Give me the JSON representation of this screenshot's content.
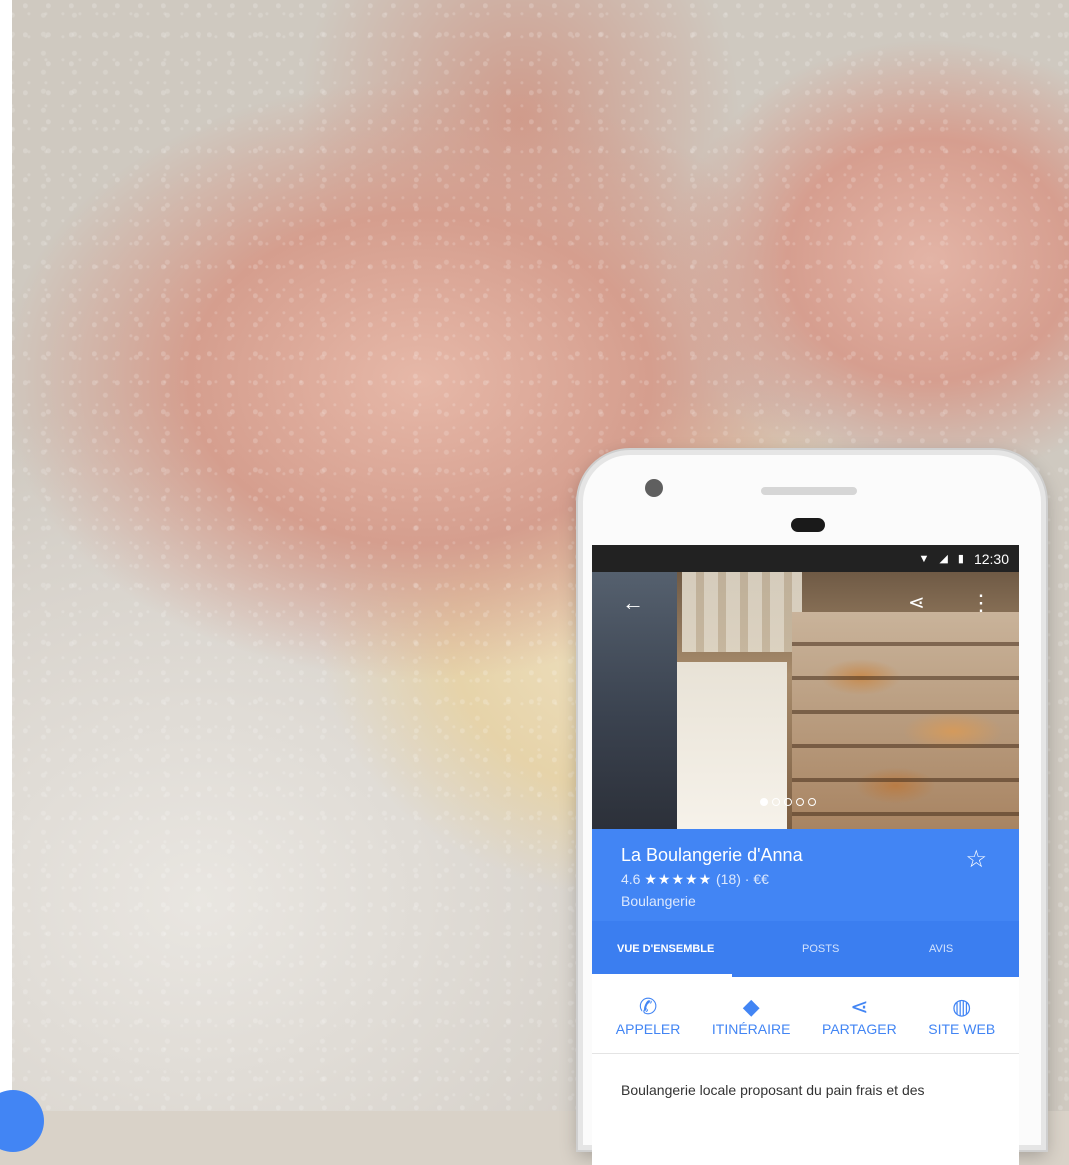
{
  "status_bar": {
    "time": "12:30"
  },
  "place": {
    "name": "La Boulangerie d'Anna",
    "rating": "4.6",
    "stars": "★★★★★",
    "reviews_price": "(18) · €€",
    "category": "Boulangerie"
  },
  "tabs": [
    {
      "label": "VUE D'ENSEMBLE",
      "active": true
    },
    {
      "label": "POSTS",
      "active": false
    },
    {
      "label": "AVIS",
      "active": false
    }
  ],
  "actions": [
    {
      "label": "APPELER",
      "icon": "phone-icon"
    },
    {
      "label": "ITINÉRAIRE",
      "icon": "directions-icon"
    },
    {
      "label": "PARTAGER",
      "icon": "share-icon"
    },
    {
      "label": "SITE WEB",
      "icon": "globe-icon"
    }
  ],
  "description": "Boulangerie locale proposant du pain frais et des",
  "colors": {
    "brand_blue": "#4285f4",
    "tab_blue": "#3b7ef0"
  },
  "carousel": {
    "count": 5,
    "active_index": 0
  }
}
